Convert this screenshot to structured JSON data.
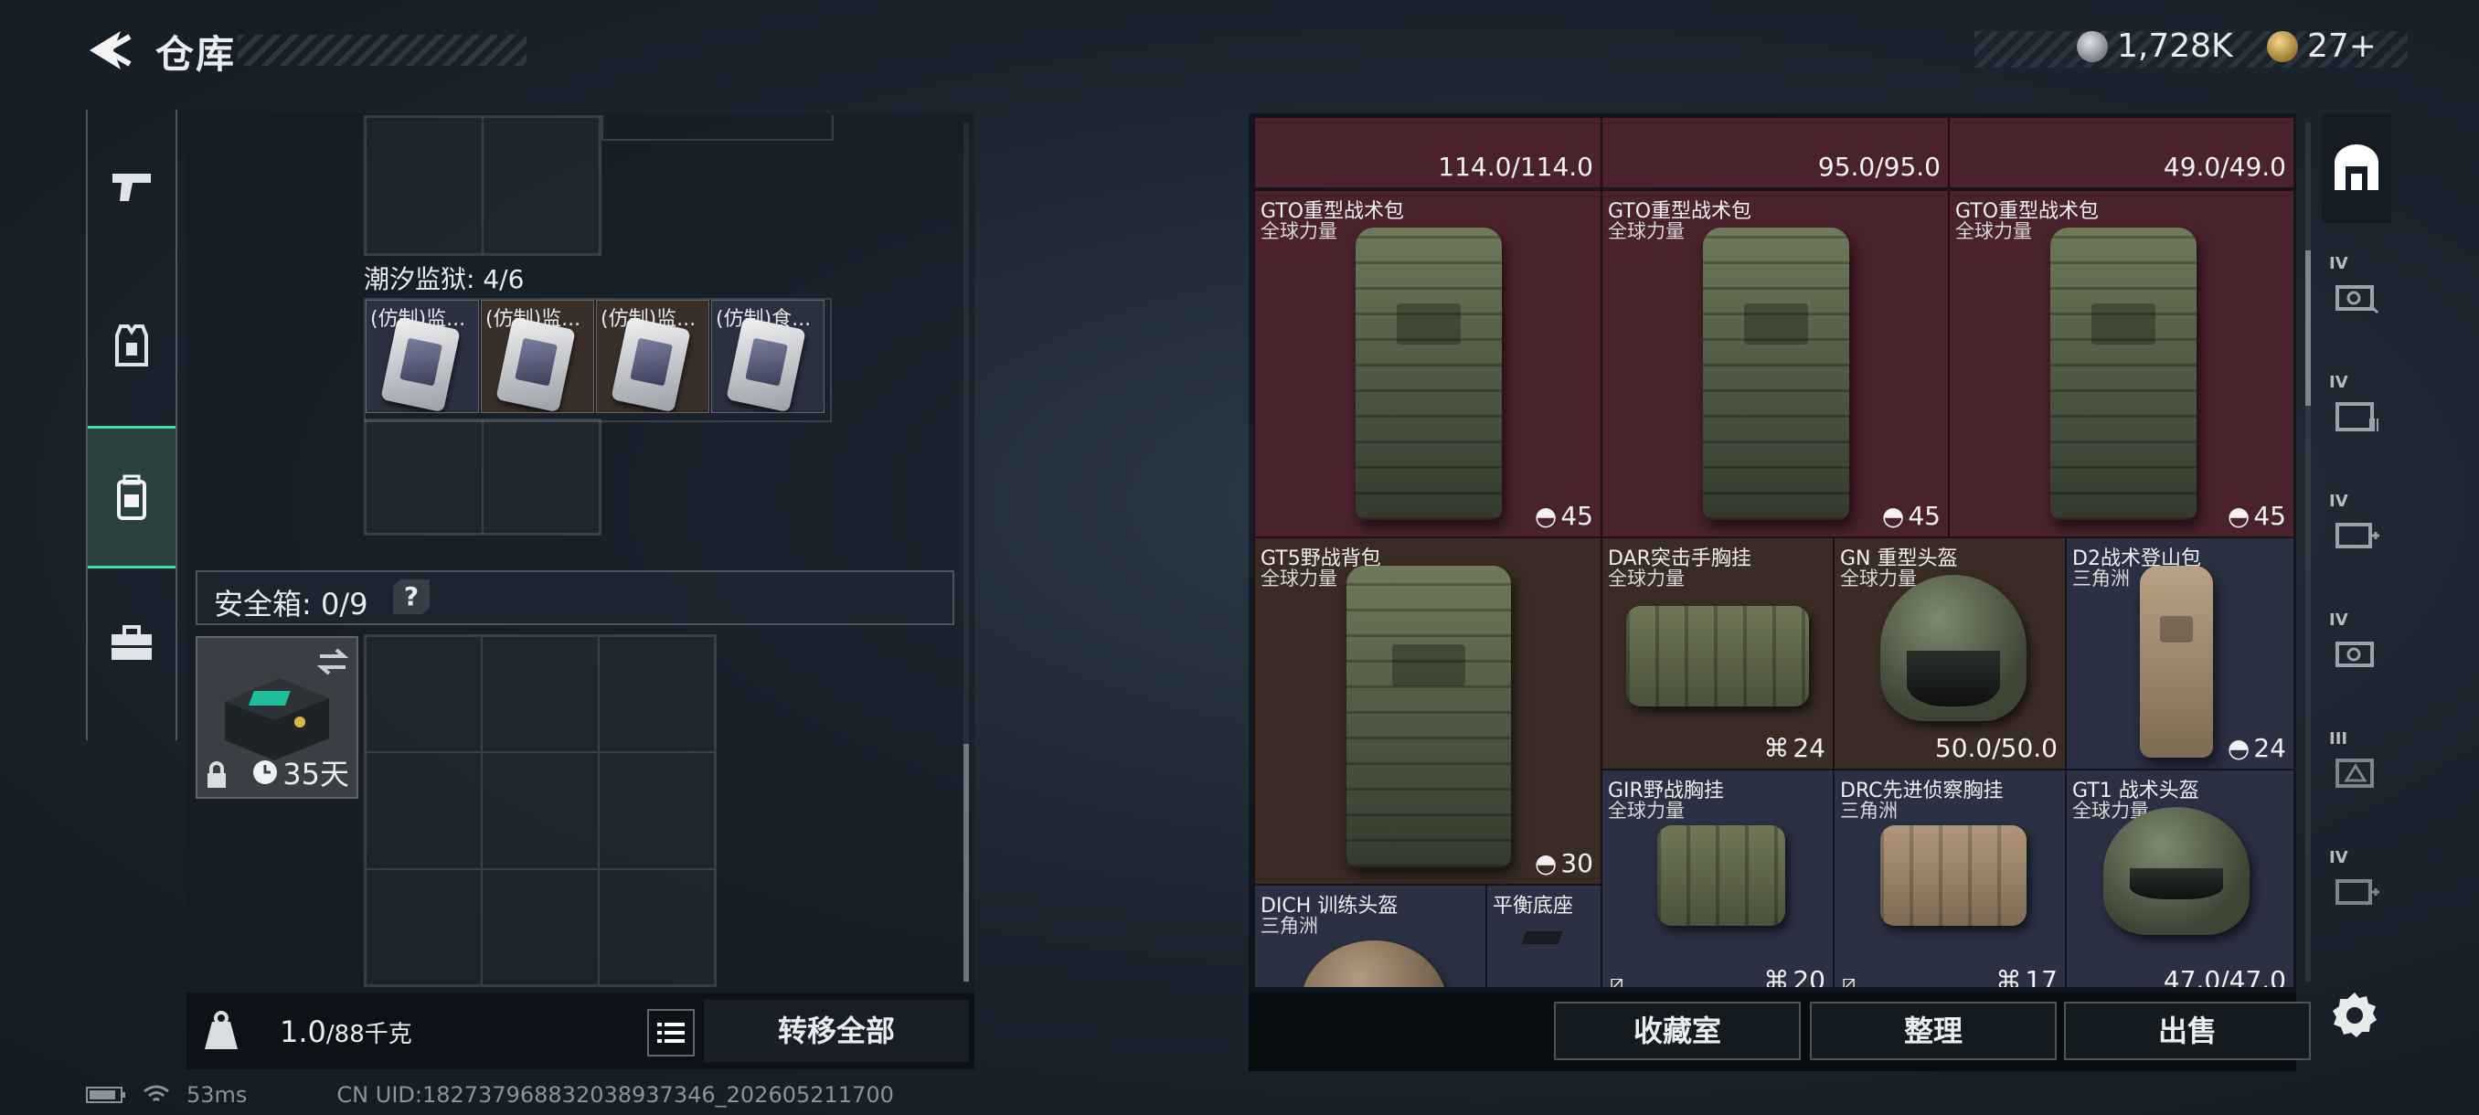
{
  "header": {
    "title": "仓库"
  },
  "currency": {
    "coins": "1,728K",
    "tickets": "27+"
  },
  "nav": [
    {
      "icon": "pistol-icon"
    },
    {
      "icon": "armor-vest-icon"
    },
    {
      "icon": "backpack-icon"
    },
    {
      "icon": "toolbox-icon"
    }
  ],
  "stash": {
    "section_title": "潮汐监狱: 4/6",
    "items": [
      {
        "name": "(仿制)监..."
      },
      {
        "name": "(仿制)监..."
      },
      {
        "name": "(仿制)监..."
      },
      {
        "name": "(仿制)食..."
      }
    ],
    "safe_box_label": "安全箱: 0/9",
    "help_label": "?",
    "safe_item_days": "35天",
    "weight_value": "1.0",
    "weight_max": "/88千克",
    "transfer_all_label": "转移全部"
  },
  "status": {
    "ping": "53ms",
    "uid": "CN UID:182737968832038937346_202605211700"
  },
  "container": {
    "top_row": [
      {
        "value": "114.0/114.0"
      },
      {
        "value": "95.0/95.0"
      },
      {
        "value": "49.0/49.0"
      }
    ],
    "items": [
      {
        "name": "GTO重型战术包",
        "faction": "全球力量",
        "badge": "45"
      },
      {
        "name": "GTO重型战术包",
        "faction": "全球力量",
        "badge": "45"
      },
      {
        "name": "GTO重型战术包",
        "faction": "全球力量",
        "badge": "45"
      },
      {
        "name": "GT5野战背包",
        "faction": "全球力量",
        "badge": "30"
      },
      {
        "name": "DAR突击手胸挂",
        "faction": "全球力量",
        "badge": "24"
      },
      {
        "name": "GN 重型头盔",
        "faction": "全球力量",
        "badge": "50.0/50.0"
      },
      {
        "name": "D2战术登山包",
        "faction": "三角洲",
        "badge": "24"
      },
      {
        "name": "GIR野战胸挂",
        "faction": "全球力量",
        "badge": "20"
      },
      {
        "name": "DRC先进侦察胸挂",
        "faction": "三角洲",
        "badge": "17"
      },
      {
        "name": "GT1 战术头盔",
        "faction": "全球力量",
        "badge": "47.0/47.0"
      },
      {
        "name": "DICH 训练头盔",
        "faction": "三角洲",
        "badge": ""
      },
      {
        "name": "平衡底座",
        "faction": "",
        "badge": ""
      }
    ],
    "buttons": {
      "collection": "收藏室",
      "organize": "整理",
      "sell": "出售"
    }
  },
  "right_nav": [
    {
      "icon": "safehouse-icon",
      "tier": ""
    },
    {
      "icon": "case-iv-icon",
      "tier": "IV"
    },
    {
      "icon": "case-iv-icon",
      "tier": "IV"
    },
    {
      "icon": "medkit-iv-icon",
      "tier": "IV"
    },
    {
      "icon": "case-iv-icon",
      "tier": "IV"
    },
    {
      "icon": "case-iii-icon",
      "tier": "III"
    },
    {
      "icon": "medkit-iv-icon",
      "tier": "IV"
    }
  ]
}
